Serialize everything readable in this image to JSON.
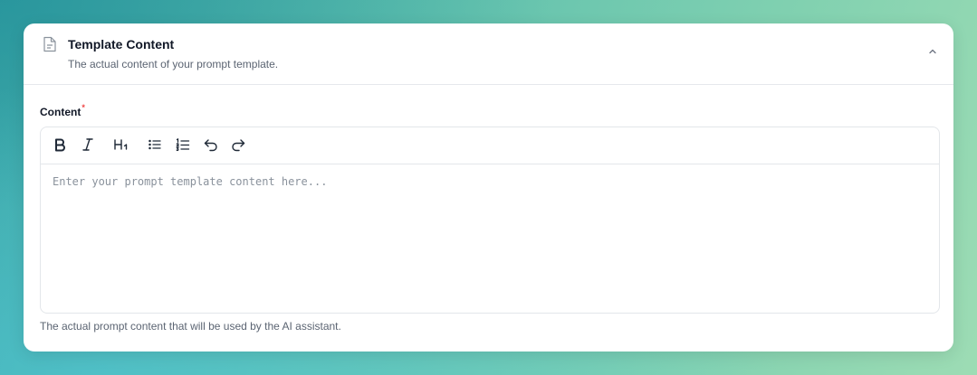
{
  "card": {
    "title": "Template Content",
    "description": "The actual content of your prompt template.",
    "icon": "document-icon",
    "collapse_icon": "chevron-up-icon"
  },
  "field": {
    "label": "Content",
    "required_mark": "*",
    "value": "",
    "placeholder": "Enter your prompt template content here...",
    "helper": "The actual prompt content that will be used by the AI assistant."
  },
  "toolbar": {
    "tools": [
      "bold-icon",
      "italic-icon",
      "heading-1-icon",
      "bullet-list-icon",
      "ordered-list-icon",
      "undo-icon",
      "redo-icon"
    ]
  },
  "colors": {
    "required": "#ef4444",
    "text_primary": "#111827",
    "text_muted": "#5b6472",
    "border": "#e3e6ea"
  }
}
